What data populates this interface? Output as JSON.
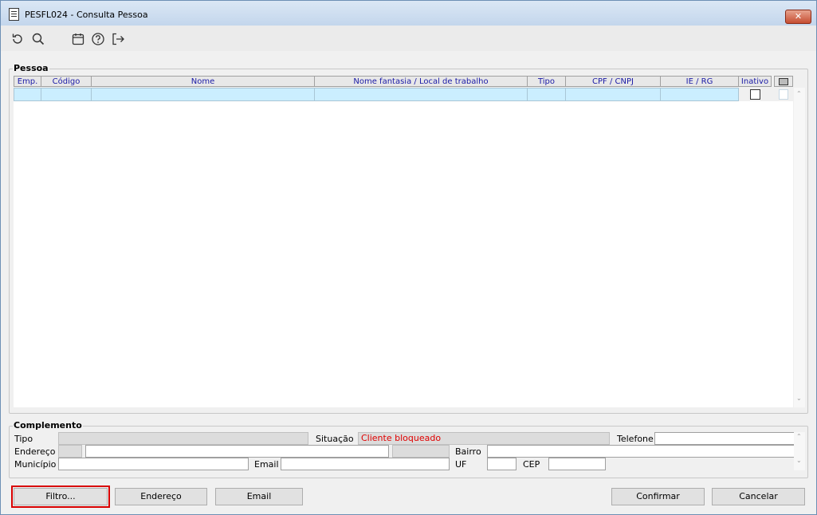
{
  "window": {
    "title": "PESFL024 - Consulta Pessoa",
    "close_label": "✕"
  },
  "toolbar": {
    "icons": [
      "refresh-icon",
      "search-icon",
      "calendar-icon",
      "help-icon",
      "exit-icon"
    ]
  },
  "pessoa": {
    "legend": "Pessoa",
    "columns": [
      "Emp.",
      "Código",
      "Nome",
      "Nome fantasia / Local de trabalho",
      "Tipo",
      "CPF / CNPJ",
      "IE / RG",
      "Inativo"
    ],
    "rows": [
      {
        "emp": "",
        "codigo": "",
        "nome": "",
        "nome_fantasia": "",
        "tipo": "",
        "cpf_cnpj": "",
        "ie_rg": "",
        "inativo": false
      }
    ]
  },
  "complemento": {
    "legend": "Complemento",
    "tipo_label": "Tipo",
    "tipo_value": "",
    "situacao_label": "Situação",
    "situacao_value": "Cliente bloqueado",
    "telefone_label": "Telefone",
    "telefone_value": "",
    "endereco_label": "Endereço",
    "endereco_value": "",
    "bairro_label": "Bairro",
    "bairro_value": "",
    "municipio_label": "Município",
    "municipio_value": "",
    "email_label": "Email",
    "email_value": "",
    "uf_label": "UF",
    "uf_value": "",
    "cep_label": "CEP",
    "cep_value": ""
  },
  "buttons": {
    "filtro": "Filtro...",
    "endereco": "Endereço",
    "email": "Email",
    "confirmar": "Confirmar",
    "cancelar": "Cancelar"
  },
  "colors": {
    "selected_row": "#cbeeff",
    "header_text": "#1a1aa6",
    "warning_text": "#e00000",
    "focus_outline": "#d80000"
  }
}
